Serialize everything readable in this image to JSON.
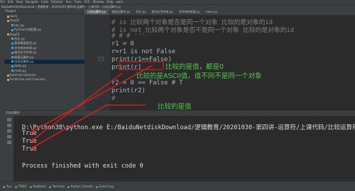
{
  "menu": {
    "items": [
      "File",
      "Edit",
      "View",
      "Navigate",
      "Code",
      "Refactor",
      "Run",
      "Tools",
      "VCS",
      "Window",
      "Help",
      "work"
    ]
  },
  "breadcrumb": {
    "text": "BaiduNetdiskDownload › 逻辑教育 › 20201030-第四讲-运算符 › 上课代码 › 比较运算符.py"
  },
  "project": {
    "header": "Project",
    "items": [
      {
        "label": "work",
        "type": "folder"
      },
      {
        "label": "Day02",
        "type": "folder"
      },
      {
        "label": "abc.py",
        "type": "file"
      },
      {
        "label": "PyCharm的配置.py",
        "type": "file"
      },
      {
        "label": "Day03",
        "type": "folder"
      },
      {
        "label": "作业.py",
        "type": "file"
      },
      {
        "label": "基本数据类型.py",
        "type": "file"
      },
      {
        "label": "字符串的拼接.py",
        "type": "file"
      },
      {
        "label": "格式化字符串.py",
        "type": "file"
      },
      {
        "label": "赋值运算符.py",
        "type": "file"
      },
      {
        "label": "比较运算符.py",
        "type": "file",
        "selected": true
      },
      {
        "label": "Hello.py",
        "type": "file"
      },
      {
        "label": "main.py",
        "type": "file"
      },
      {
        "label": "External Libraries",
        "type": "folder"
      },
      {
        "label": "Scratches and Consoles",
        "type": "folder"
      }
    ]
  },
  "tabs": [
    "比较运算符.py",
    "赋值运算符.py",
    "作业.py",
    "格式化字符串.py",
    "字符串的拼接.py",
    "main.py"
  ],
  "editor": {
    "line_numbers": [
      "",
      "",
      "",
      "",
      "",
      "",
      "55",
      "",
      "",
      "",
      "",
      "",
      "",
      ""
    ],
    "lines": [
      {
        "text": "# is 比较两个对象是否是同一个对象 比较的是对象的id",
        "cls": "cmt"
      },
      {
        "text": "# is not 比较两个对象是否不是同一个对象 比较的是对象的id",
        "cls": "cmt"
      },
      {
        "text": "# # # '''",
        "cls": "cmt"
      },
      {
        "text": "r1 = 0",
        "cls": ""
      },
      {
        "text": "r=r1 is not False",
        "cls": ""
      },
      {
        "text": "print(r1==False)",
        "cls": ""
      },
      {
        "text": "print(r)",
        "cls": ""
      },
      {
        "text": "",
        "cls": ""
      },
      {
        "text": "r2 = 0 == False # T",
        "cls": ""
      },
      {
        "text": "print(r2)",
        "cls": ""
      },
      {
        "text": "#",
        "cls": "cmt"
      }
    ]
  },
  "annotations": [
    "比较的是值，都是0",
    "比较的是ASCII值，值不同不是同一个对象",
    "比较的是值"
  ],
  "run": {
    "tab": "比较运算符",
    "command": "D:\\Python38\\python.exe E:/BaiduNetdiskDownload/逻辑教育/20201030-第四讲-运算符/上课代码/比较运算符.py",
    "outputs": [
      "True",
      "True",
      "True"
    ],
    "exit": "Process finished with exit code 0"
  },
  "status": {
    "items": [
      "Run",
      "TODO",
      "Problems",
      "Terminal",
      "Python Console",
      "Event Log"
    ]
  },
  "colors": {
    "annotation": "#4ec94e",
    "arrow": "#e0201f",
    "bg": "#2b2b2b"
  }
}
